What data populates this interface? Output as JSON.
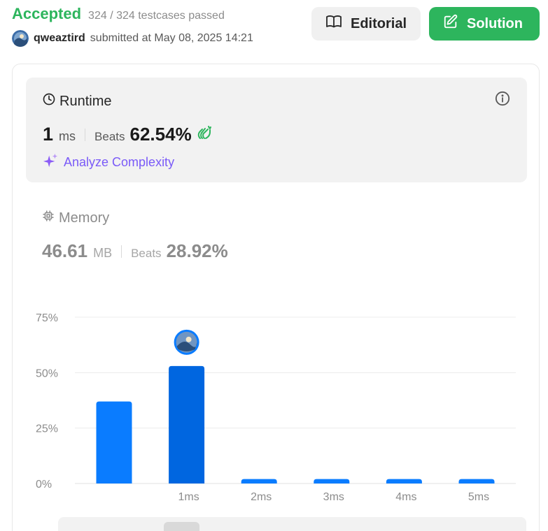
{
  "header": {
    "status": "Accepted",
    "testcases": "324 / 324 testcases passed",
    "username": "qweaztird",
    "submitted_text": "submitted at May 08, 2025 14:21",
    "editorial_label": "Editorial",
    "solution_label": "Solution"
  },
  "runtime": {
    "title": "Runtime",
    "value": "1",
    "unit": "ms",
    "beats_label": "Beats",
    "beats_pct": "62.54%",
    "analyze_label": "Analyze Complexity"
  },
  "memory": {
    "title": "Memory",
    "value": "46.61",
    "unit": "MB",
    "beats_label": "Beats",
    "beats_pct": "28.92%"
  },
  "colors": {
    "accepted": "#2db55d",
    "bar": "#0a7cff",
    "bar_selected": "#0066e0",
    "analyze": "#7a5af8"
  },
  "chart_data": {
    "type": "bar",
    "categories": [
      "",
      "1ms",
      "2ms",
      "3ms",
      "4ms",
      "5ms"
    ],
    "values": [
      37,
      53,
      2,
      2,
      2,
      2
    ],
    "selected_index": 1,
    "yticks": [
      "0%",
      "25%",
      "50%",
      "75%"
    ],
    "ylim": [
      0,
      75
    ],
    "grid": true
  }
}
